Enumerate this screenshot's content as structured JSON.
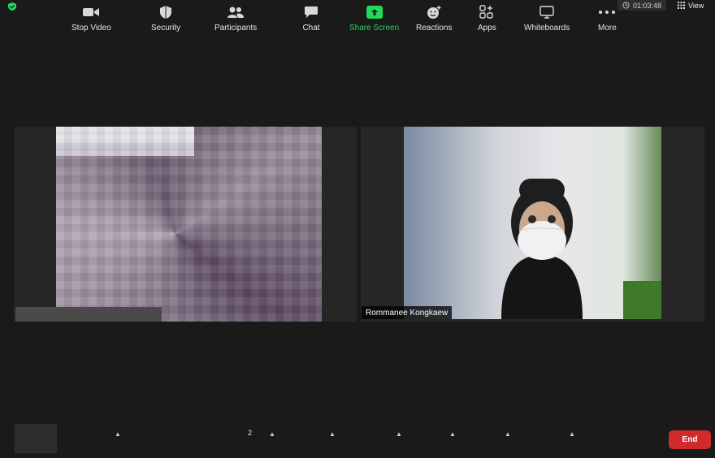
{
  "top_bar": {
    "timer": "01:03:48",
    "view_label": "View"
  },
  "participants": [
    {
      "name": "",
      "video": "pixelated"
    },
    {
      "name": "Rommanee Kongkaew",
      "video": "camera"
    }
  ],
  "toolbar": {
    "stop_video": "Stop Video",
    "security": "Security",
    "participants": "Participants",
    "participants_count": "2",
    "chat": "Chat",
    "share_screen": "Share Screen",
    "reactions": "Reactions",
    "apps": "Apps",
    "whiteboards": "Whiteboards",
    "more": "More",
    "end": "End"
  },
  "colors": {
    "background": "#1a1a1a",
    "share_green": "#23d959",
    "end_red": "#d02b2b",
    "security_shield": "#23d959"
  }
}
